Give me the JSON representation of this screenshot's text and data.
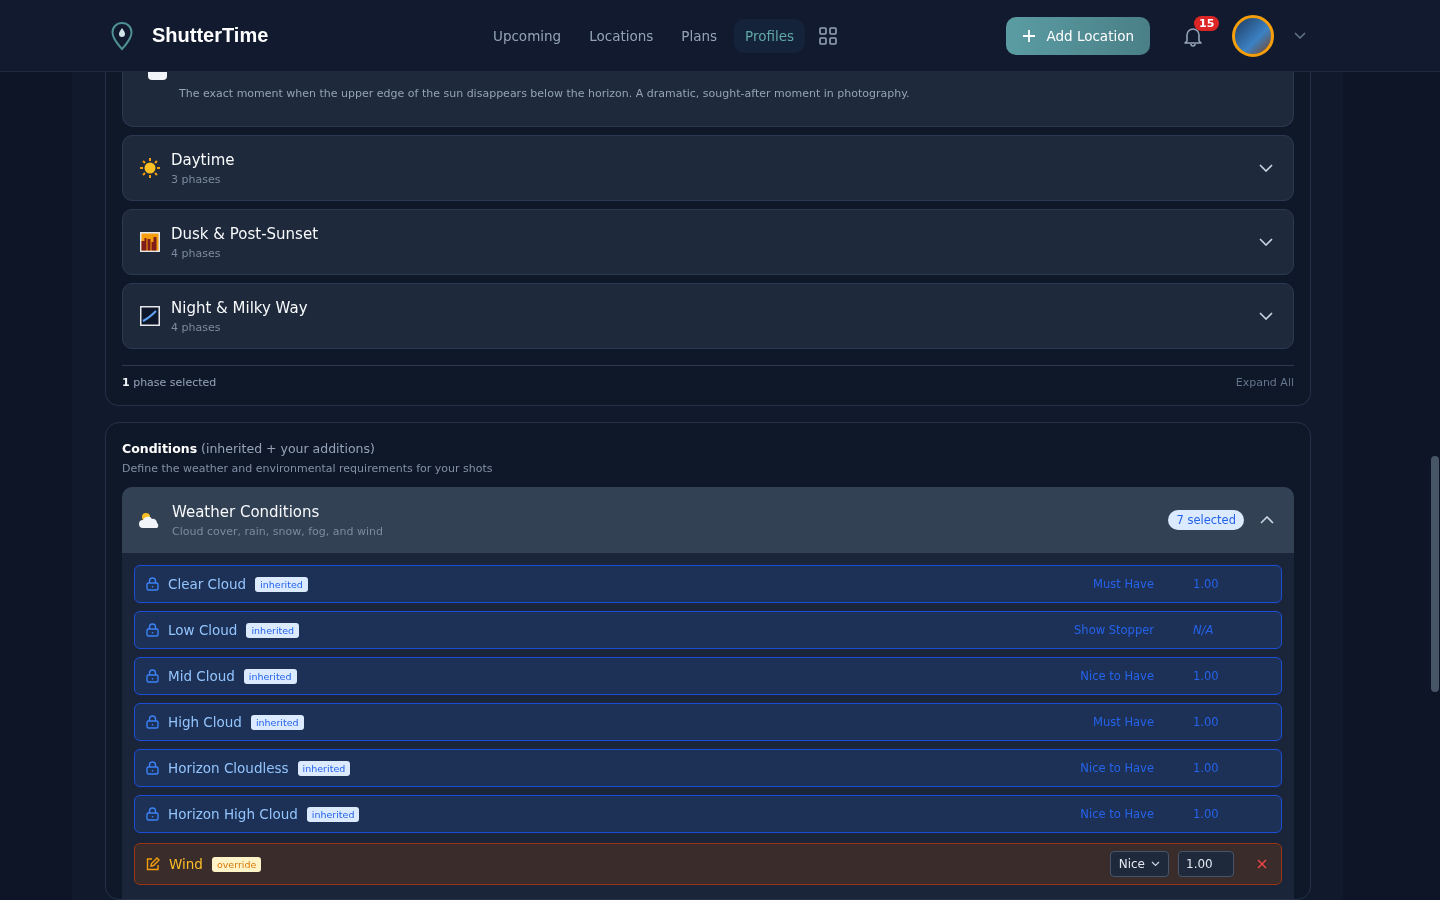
{
  "brand": "ShutterTime",
  "nav": [
    {
      "label": "Upcoming",
      "selected": false
    },
    {
      "label": "Locations",
      "selected": false
    },
    {
      "label": "Plans",
      "selected": false
    },
    {
      "label": "Profiles",
      "selected": true
    }
  ],
  "add_button": "Add Location",
  "notifications": "15",
  "phases_card": {
    "partial_phase": {
      "checked": false,
      "description": "The exact moment when the upper edge of the sun disappears below the horizon. A dramatic, sought-after moment in photography."
    },
    "groups": [
      {
        "kind": "sun",
        "title": "Daytime",
        "count": "3 phases",
        "expanded": false
      },
      {
        "kind": "dusk",
        "title": "Dusk & Post-Sunset",
        "count": "4 phases",
        "expanded": false
      },
      {
        "kind": "night",
        "title": "Night & Milky Way",
        "count": "4 phases",
        "expanded": false
      }
    ],
    "footer": "**1** phase selected",
    "expand_all": "Expand All"
  },
  "conditions": {
    "title": "**Conditions** (inherited + your additions)",
    "subtitle": "Define the weather and environmental requirements for your shots",
    "group": {
      "title": "Weather Conditions",
      "subtitle": "Cloud cover, rain, snow, fog, and wind",
      "badge": "7 selected",
      "expanded": true,
      "rows": [
        {
          "kind": "inherited",
          "name": "Clear Cloud",
          "tag": "inherited",
          "priority": "Must Have",
          "weight": "1.00"
        },
        {
          "kind": "inherited",
          "name": "Low Cloud",
          "tag": "inherited",
          "priority": "Show Stopper",
          "weight": "N/A"
        },
        {
          "kind": "inherited",
          "name": "Mid Cloud",
          "tag": "inherited",
          "priority": "Nice to Have",
          "weight": "1.00"
        },
        {
          "kind": "inherited",
          "name": "High Cloud",
          "tag": "inherited",
          "priority": "Must Have",
          "weight": "1.00"
        },
        {
          "kind": "inherited",
          "name": "Horizon Cloudless",
          "tag": "inherited",
          "priority": "Nice to Have",
          "weight": "1.00"
        },
        {
          "kind": "inherited",
          "name": "Horizon High Cloud",
          "tag": "inherited",
          "priority": "Nice to Have",
          "weight": "1.00"
        },
        {
          "kind": "override",
          "name": "Wind",
          "tag": "override",
          "priority": "Nice",
          "weight": "1.00"
        }
      ]
    }
  }
}
